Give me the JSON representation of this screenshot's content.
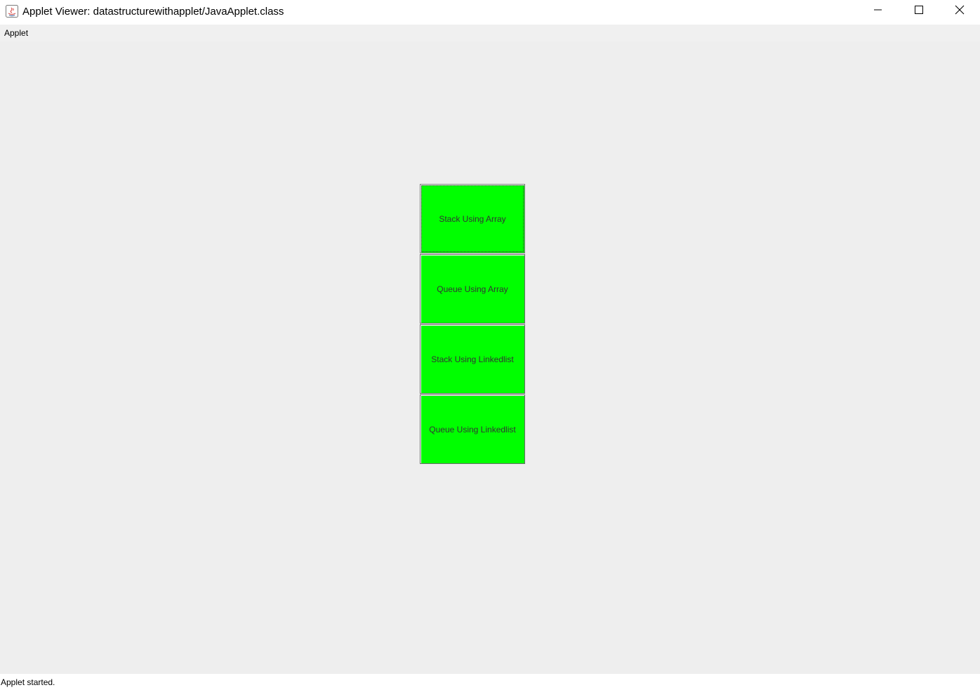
{
  "window": {
    "title": "Applet Viewer: datastructurewithapplet/JavaApplet.class",
    "icon": "java-icon",
    "controls": {
      "minimize_icon": "minimize-icon",
      "maximize_icon": "maximize-icon",
      "close_icon": "close-icon"
    }
  },
  "menubar": {
    "items": [
      {
        "label": "Applet"
      }
    ]
  },
  "applet": {
    "button_color": "#00ff00",
    "buttons": [
      {
        "label": "Stack Using Array",
        "focused": true
      },
      {
        "label": "Queue Using Array",
        "focused": false
      },
      {
        "label": "Stack Using Linkedlist",
        "focused": false
      },
      {
        "label": "Queue Using Linkedlist",
        "focused": false
      }
    ]
  },
  "status": {
    "text": "Applet started."
  }
}
